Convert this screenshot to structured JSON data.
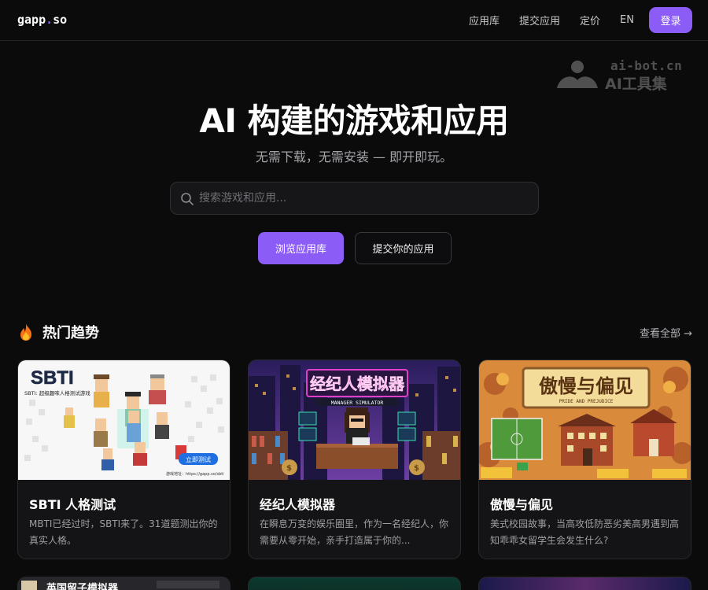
{
  "header": {
    "logo_main": "gapp",
    "logo_dot": ".",
    "logo_tld": "so",
    "nav": [
      "应用库",
      "提交应用",
      "定价",
      "EN"
    ],
    "login": "登录"
  },
  "watermark": {
    "line1": "ai-bot.cn",
    "line2": "AI工具集"
  },
  "hero": {
    "title": "AI 构建的游戏和应用",
    "subtitle": "无需下载，无需安装 — 即开即玩。",
    "search_placeholder": "搜索游戏和应用...",
    "browse_button": "浏览应用库",
    "submit_button": "提交你的应用"
  },
  "trending": {
    "title": "热门趋势",
    "view_all": "查看全部 →",
    "cards": [
      {
        "title": "SBTI 人格测试",
        "desc": "MBTI已经过时，SBTI来了。31道题测出你的真实人格。",
        "thumb_title": "SBTI",
        "thumb_sub": "SBTI: 超级趣味人格测试游戏",
        "thumb_btn": "立即测试",
        "thumb_url": "游戏地址：https://gapp.so/sbti"
      },
      {
        "title": "经纪人模拟器",
        "desc": "在瞬息万变的娱乐圈里，作为一名经纪人，你需要从零开始，亲手打造属于你的...",
        "thumb_title": "经纪人模拟器",
        "thumb_sub": "MANAGER SIMULATOR"
      },
      {
        "title": "傲慢与偏见",
        "desc": "美式校园故事，当高攻低防恶劣美高男遇到高知乖乖女留学生会发生什么?",
        "thumb_title": "傲慢与偏见",
        "thumb_sub": "PRIDE AND PREJUDICE"
      }
    ],
    "next_row": [
      "英国留子模拟器",
      "",
      ""
    ]
  },
  "colors": {
    "accent": "#8b5cf6",
    "background": "#0b0b0c",
    "card": "#141416"
  }
}
